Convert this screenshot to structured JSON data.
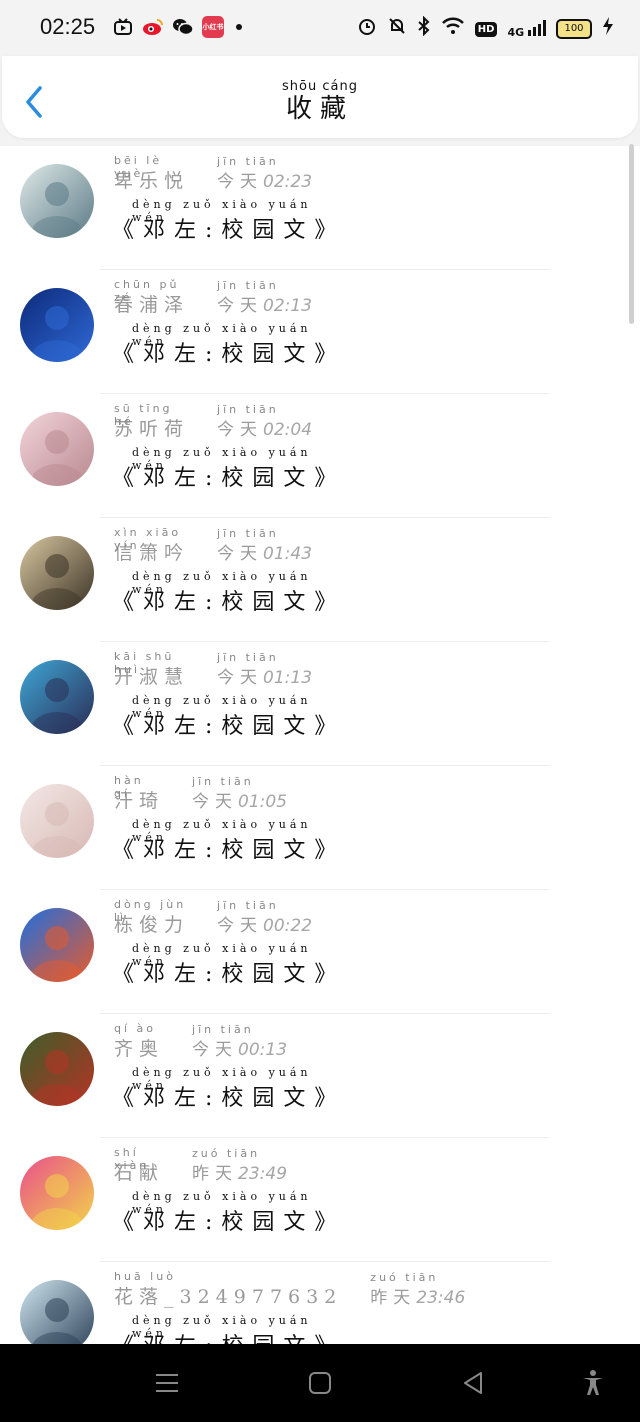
{
  "status_bar": {
    "time": "02:25",
    "apps": [
      "video-app-icon",
      "weibo-icon",
      "wechat-icon",
      "xiaohongshu-icon"
    ],
    "xhs_label": "小红书",
    "network": "4G",
    "hd": "HD",
    "battery": "100"
  },
  "header": {
    "title": "收藏",
    "title_pinyin": "shōu cáng",
    "back_icon": "chevron-left-icon"
  },
  "items": [
    {
      "name": "卑乐悦",
      "name_py": "bēi lè yuè",
      "day": "今天",
      "day_py": "jīn tiān",
      "time": "02:23",
      "work": "《邓左:校园文》",
      "work_py": "dèng zuǒ   xiào yuán wén",
      "avatar_colors": [
        "#dfe9e8",
        "#5b7a86"
      ]
    },
    {
      "name": "春浦泽",
      "name_py": "chūn pǔ zé",
      "day": "今天",
      "day_py": "jīn tiān",
      "time": "02:13",
      "work": "《邓左:校园文》",
      "work_py": "dèng zuǒ   xiào yuán wén",
      "avatar_colors": [
        "#0d2a7a",
        "#2f6ad6"
      ]
    },
    {
      "name": "苏听荷",
      "name_py": "sū tīng hé",
      "day": "今天",
      "day_py": "jīn tiān",
      "time": "02:04",
      "work": "《邓左:校园文》",
      "work_py": "dèng zuǒ   xiào yuán wén",
      "avatar_colors": [
        "#f2d5da",
        "#b98890"
      ]
    },
    {
      "name": "信箫吟",
      "name_py": "xìn xiāo yín",
      "day": "今天",
      "day_py": "jīn tiān",
      "time": "01:43",
      "work": "《邓左:校园文》",
      "work_py": "dèng zuǒ   xiào yuán wén",
      "avatar_colors": [
        "#d8c7a0",
        "#3b3326"
      ]
    },
    {
      "name": "开淑慧",
      "name_py": "kāi shū huì",
      "day": "今天",
      "day_py": "jīn tiān",
      "time": "01:13",
      "work": "《邓左:校园文》",
      "work_py": "dèng zuǒ   xiào yuán wén",
      "avatar_colors": [
        "#3fa7d6",
        "#2a2d55"
      ]
    },
    {
      "name": "汗琦",
      "name_py": "hàn qí",
      "day": "今天",
      "day_py": "jīn tiān",
      "time": "01:05",
      "work": "《邓左:校园文》",
      "work_py": "dèng zuǒ   xiào yuán wén",
      "avatar_colors": [
        "#f3e8e6",
        "#d7b9b4"
      ]
    },
    {
      "name": "栋俊力",
      "name_py": "dòng jùn lì",
      "day": "今天",
      "day_py": "jīn tiān",
      "time": "00:22",
      "work": "《邓左:校园文》",
      "work_py": "dèng zuǒ   xiào yuán wén",
      "avatar_colors": [
        "#1e6fe0",
        "#e85a2a"
      ]
    },
    {
      "name": "齐奥",
      "name_py": "qí ào",
      "day": "今天",
      "day_py": "jīn tiān",
      "time": "00:13",
      "work": "《邓左:校园文》",
      "work_py": "dèng zuǒ   xiào yuán wén",
      "avatar_colors": [
        "#3c5e2a",
        "#b63325"
      ]
    },
    {
      "name": "石献",
      "name_py": "shí xiàn",
      "day": "昨天",
      "day_py": "zuó tiān",
      "time": "23:49",
      "work": "《邓左:校园文》",
      "work_py": "dèng zuǒ   xiào yuán wén",
      "avatar_colors": [
        "#e94f8a",
        "#f2d44a"
      ]
    },
    {
      "name": "花落_324977632",
      "name_py": "huā luò",
      "day": "昨天",
      "day_py": "zuó tiān",
      "time": "23:46",
      "work": "《邓左:校园文》",
      "work_py": "dèng zuǒ   xiào yuán wén",
      "avatar_colors": [
        "#cfe6f0",
        "#2b3f55"
      ]
    }
  ],
  "nav_bar": {
    "buttons": [
      "menu-icon",
      "home-icon",
      "back-triangle-icon",
      "accessibility-icon"
    ]
  }
}
